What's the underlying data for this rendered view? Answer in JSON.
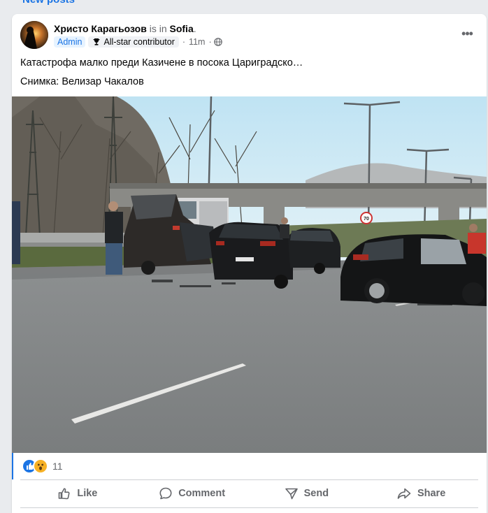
{
  "top": {
    "new_posts": "New posts"
  },
  "post": {
    "author": "Христо Карагьозов",
    "is_in": "is in",
    "location": "Sofia",
    "location_dot": ".",
    "badge_admin": "Admin",
    "badge_contributor": "All-star contributor",
    "time": "11m",
    "time_sep": "·",
    "text_line1": "Катастрофа малко преди Казичене в посока Цариградско…",
    "text_line2": "Снимка: Велизар Чакалов",
    "speed_sign": "70",
    "reaction_count": "11",
    "reactions": [
      "like-reaction",
      "wow-reaction"
    ]
  },
  "actions": {
    "like": "Like",
    "comment": "Comment",
    "send": "Send",
    "share": "Share"
  },
  "colors": {
    "accent": "#1b74e4",
    "muted": "#65676b",
    "page_bg": "#e9ebee"
  }
}
